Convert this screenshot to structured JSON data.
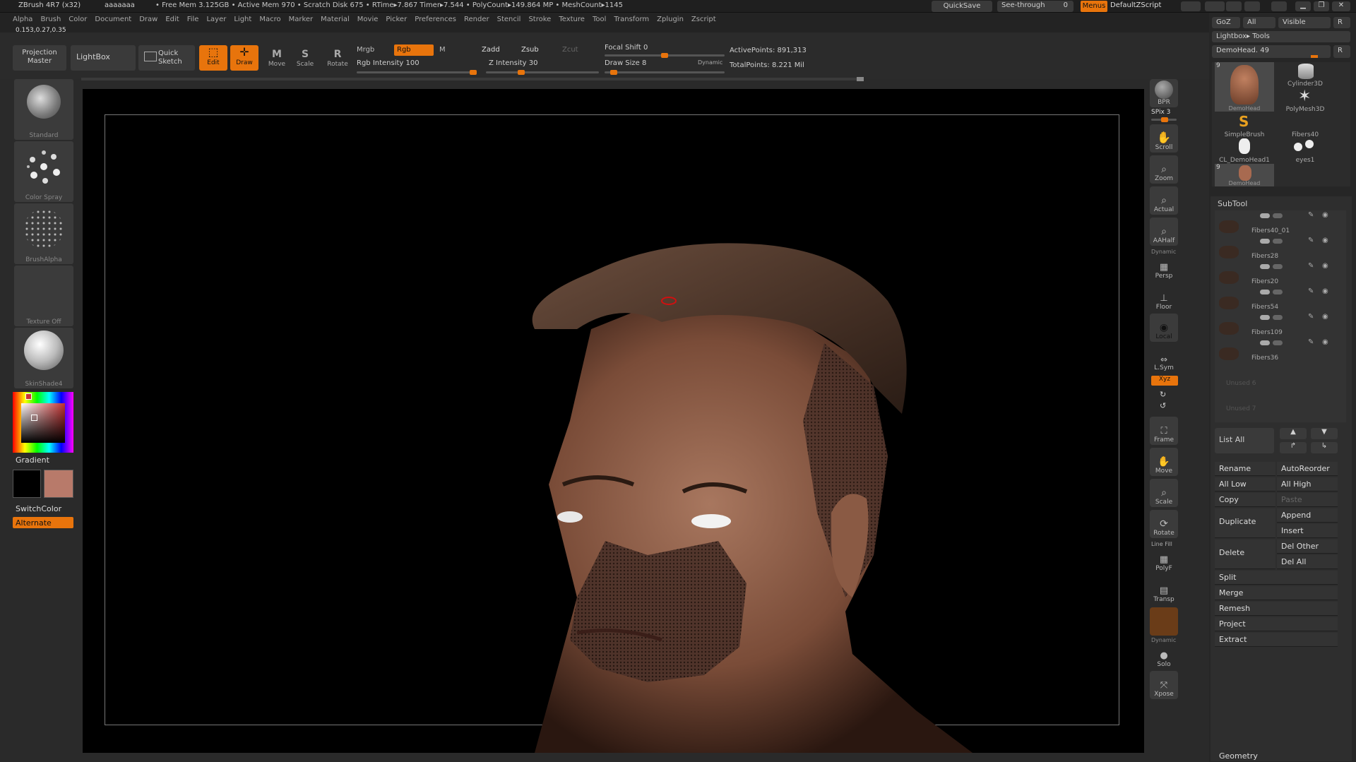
{
  "titlebar": {
    "app": "ZBrush 4R7 (x32)",
    "doc": "aaaaaaa",
    "stats": "• Free Mem 3.125GB • Active Mem 970 • Scratch Disk 675 • RTime▸7.867 Timer▸7.544 • PolyCount▸149.864 MP • MeshCount▸1145",
    "quicksave": "QuickSave",
    "seethrough": "See-through",
    "seethrough_value": "0",
    "menus": "Menus",
    "defaultscript": "DefaultZScript"
  },
  "menubar": {
    "items": [
      "Alpha",
      "Brush",
      "Color",
      "Document",
      "Draw",
      "Edit",
      "File",
      "Layer",
      "Light",
      "Macro",
      "Marker",
      "Material",
      "Movie",
      "Picker",
      "Preferences",
      "Render",
      "Stencil",
      "Stroke",
      "Texture",
      "Tool",
      "Transform",
      "Zplugin",
      "Zscript"
    ],
    "coords": "0.153,0.27,0.35"
  },
  "toolbar": {
    "projection_master": "Projection Master",
    "lightbox": "LightBox",
    "quick_sketch": "Quick Sketch",
    "edit": "Edit",
    "draw": "Draw",
    "move": "Move",
    "scale": "Scale",
    "rotate": "Rotate",
    "mrgb": "Mrgb",
    "rgb": "Rgb",
    "m": "M",
    "rgb_intensity_label": "Rgb Intensity",
    "rgb_intensity": "100",
    "rgb_intensity_level": 1.0,
    "zadd": "Zadd",
    "zsub": "Zsub",
    "zcut": "Zcut",
    "z_intensity_label": "Z Intensity",
    "z_intensity": "30",
    "z_intensity_level": 0.3,
    "focal_shift_label": "Focal Shift",
    "focal_shift": "0",
    "draw_size_label": "Draw Size",
    "draw_size": "8",
    "draw_size_level": 0.05,
    "dynamic": "Dynamic",
    "active_points_label": "ActivePoints:",
    "active_points": "891,313",
    "total_points_label": "TotalPoints:",
    "total_points": "8.221 Mil"
  },
  "leftshelf": {
    "brush": "Standard",
    "stroke": "Color Spray",
    "alpha": "BrushAlpha",
    "texture": "Texture Off",
    "material": "SkinShade4",
    "gradient": "Gradient",
    "switchcolor": "SwitchColor",
    "alternate": "Alternate",
    "main_color": "#000000",
    "secondary_color": "#b87a6a"
  },
  "rightshelf": {
    "bpr": "BPR",
    "spix_label": "SPix",
    "spix": "3",
    "scroll": "Scroll",
    "zoom": "Zoom",
    "actual": "Actual",
    "aahalf": "AAHalf",
    "dynamic": "Dynamic",
    "persp": "Persp",
    "floor": "Floor",
    "local": "Local",
    "lsym": "L.Sym",
    "xyz": "Xyz",
    "frame": "Frame",
    "move": "Move",
    "scale": "Scale",
    "rotate": "Rotate",
    "linefill": "Line Fill",
    "polyf": "PolyF",
    "transp": "Transp",
    "dynamic2": "Dynamic",
    "solo": "Solo",
    "xpose": "Xpose"
  },
  "rightpanel": {
    "goz": "GoZ",
    "all": "All",
    "visible": "Visible",
    "r": "R",
    "lightbox_tools": "Lightbox▸ Tools",
    "current_tool_label": "DemoHead.",
    "current_tool_value": "49",
    "tools": [
      {
        "name": "DemoHead",
        "badge": "9"
      },
      {
        "name": "Cylinder3D"
      },
      {
        "name": "PolyMesh3D"
      },
      {
        "name": "SimpleBrush"
      },
      {
        "name": "Fibers40"
      },
      {
        "name": "CL_DemoHead1"
      },
      {
        "name": "eyes1"
      },
      {
        "name": "DemoHead",
        "badge": "9"
      }
    ],
    "subtool_title": "SubTool",
    "subtools": [
      "Fibers40_01",
      "Fibers28",
      "Fibers20",
      "Fibers54",
      "Fibers109",
      "Fibers36",
      "Unused 6",
      "Unused 7"
    ],
    "list_all": "List All",
    "rename": "Rename",
    "autoreorder": "AutoReorder",
    "all_low": "All Low",
    "all_high": "All High",
    "copy": "Copy",
    "paste": "Paste",
    "duplicate": "Duplicate",
    "append": "Append",
    "insert": "Insert",
    "delete": "Delete",
    "del_other": "Del Other",
    "del_all": "Del All",
    "split": "Split",
    "merge": "Merge",
    "remesh": "Remesh",
    "project": "Project",
    "extract": "Extract",
    "geometry": "Geometry"
  }
}
